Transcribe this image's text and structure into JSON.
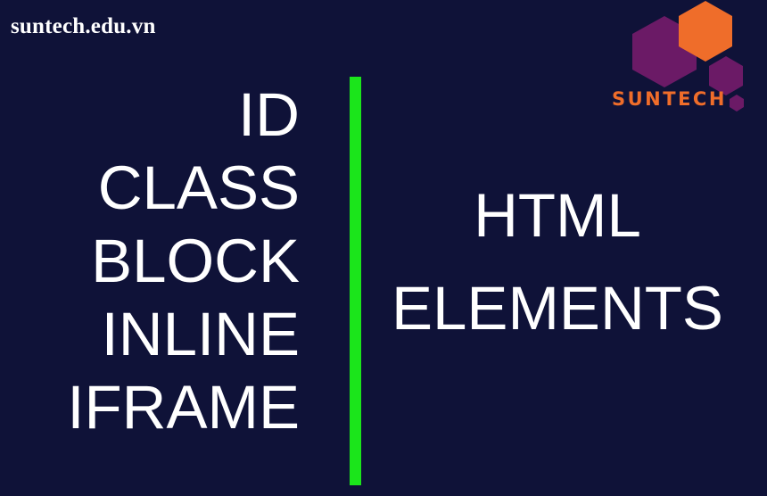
{
  "header": {
    "site_url": "suntech.edu.vn"
  },
  "logo": {
    "text": "SUNTECH",
    "colors": {
      "purple": "#6b1a66",
      "orange": "#ef6d2a"
    }
  },
  "left_list": {
    "items": [
      "ID",
      "CLASS",
      "BLOCK",
      "INLINE",
      "IFRAME"
    ]
  },
  "divider": {
    "color": "#1be51b"
  },
  "right_title": {
    "line1": "HTML",
    "line2": "ELEMENTS"
  },
  "colors": {
    "background": "#0f1238",
    "text": "#ffffff"
  }
}
